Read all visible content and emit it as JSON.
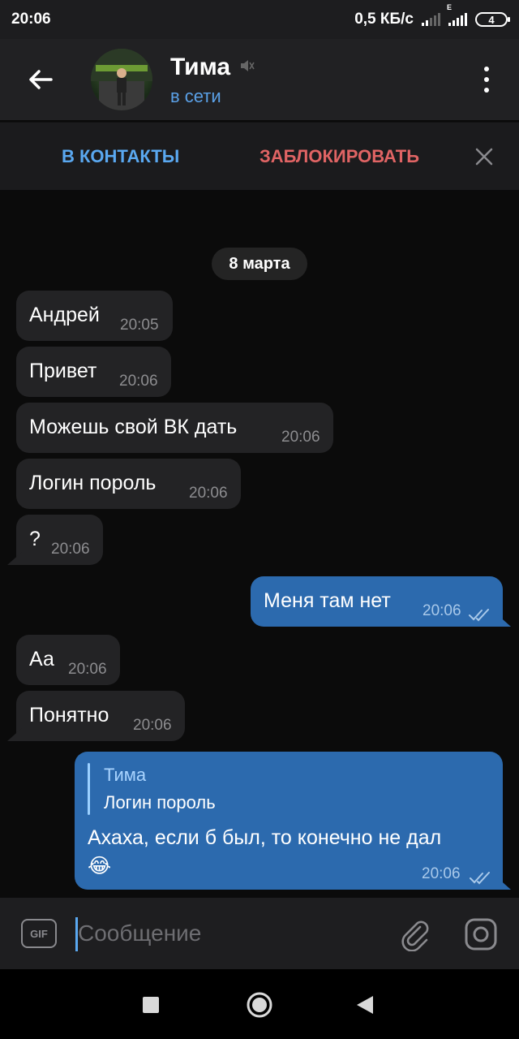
{
  "status_bar": {
    "time": "20:06",
    "network_speed": "0,5 КБ/с",
    "network_type": "E",
    "battery": "4"
  },
  "header": {
    "contact_name": "Тима",
    "contact_status": "в сети",
    "muted_icon": "mute-icon",
    "accent_color": "#5aa0e6"
  },
  "actions": {
    "add_contact": "В КОНТАКТЫ",
    "block": "ЗАБЛОКИРОВАТЬ"
  },
  "chat": {
    "date_label": "8 марта",
    "messages": [
      {
        "direction": "in",
        "text": "Андрей",
        "time": "20:05"
      },
      {
        "direction": "in",
        "text": "Привет",
        "time": "20:06"
      },
      {
        "direction": "in",
        "text": "Можешь свой ВК дать",
        "time": "20:06"
      },
      {
        "direction": "in",
        "text": "Логин пороль",
        "time": "20:06"
      },
      {
        "direction": "in",
        "text": "?",
        "time": "20:06"
      },
      {
        "direction": "out",
        "text": "Меня там нет",
        "time": "20:06",
        "read": true
      },
      {
        "direction": "in",
        "text": "Аа",
        "time": "20:06"
      },
      {
        "direction": "in",
        "text": "Понятно",
        "time": "20:06"
      },
      {
        "direction": "out",
        "reply_to_name": "Тима",
        "reply_to_text": "Логин пороль",
        "text": "Ахаха, если б был, то конечно не дал",
        "emoji": "😂",
        "time": "20:06",
        "read": true
      }
    ]
  },
  "composer": {
    "gif_label": "GIF",
    "placeholder": "Сообщение"
  },
  "colors": {
    "incoming_bubble": "#232325",
    "outgoing_bubble": "#2c6aae",
    "block_text": "#e06464",
    "add_contact_text": "#5aa8f0"
  }
}
